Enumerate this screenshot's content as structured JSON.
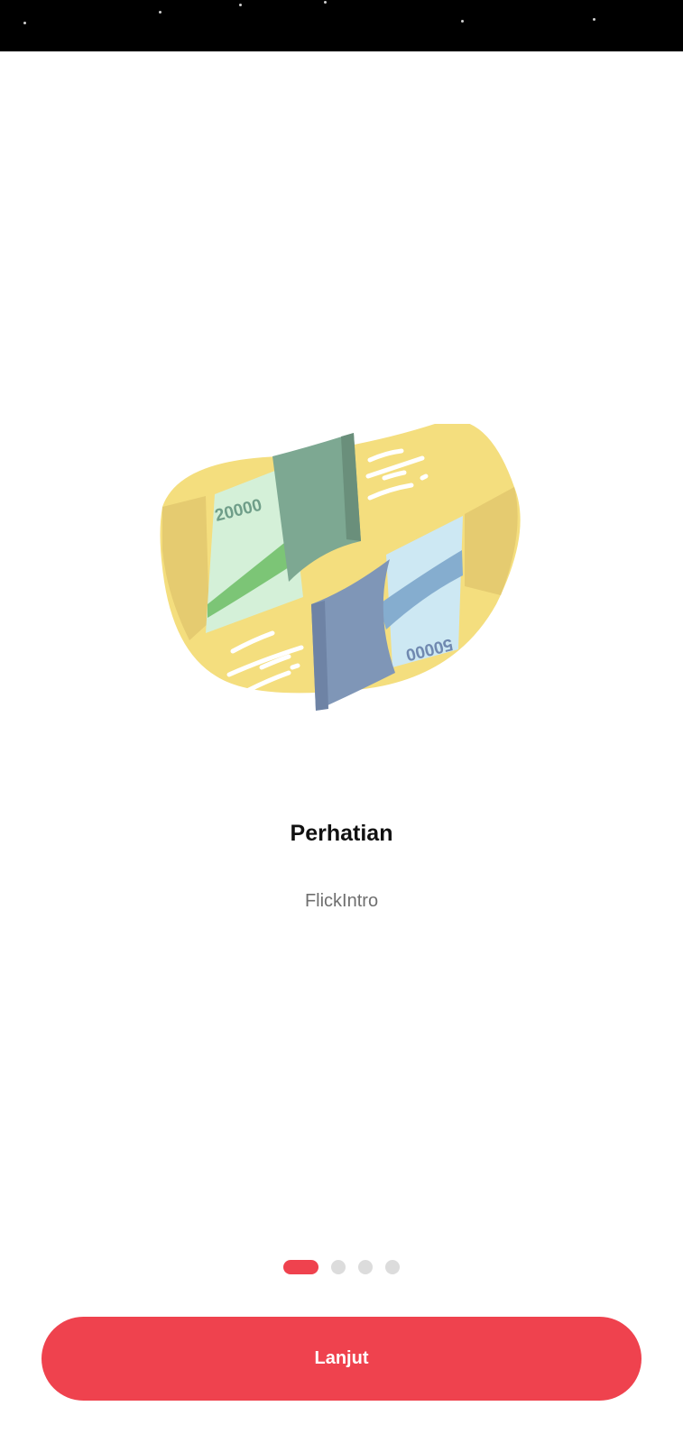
{
  "onboarding": {
    "title": "Perhatian",
    "subtitle": "FlickIntro",
    "illustration": {
      "note_green_label": "20000",
      "note_blue_label": "50000"
    }
  },
  "pager": {
    "total_pages": 4,
    "active_index": 0
  },
  "actions": {
    "next_label": "Lanjut"
  },
  "colors": {
    "accent": "#EF424E",
    "pager_inactive": "#DCDCDC",
    "blob_yellow": "#F4DE7E",
    "blob_yellow_shadow": "#E5CB70",
    "note_green_light": "#D4F0D8",
    "note_green": "#7CC576",
    "note_green_dark": "#6F9E89",
    "note_blue_light": "#CDE8F3",
    "note_blue": "#85ADCF",
    "note_blue_dark": "#7089B0"
  }
}
